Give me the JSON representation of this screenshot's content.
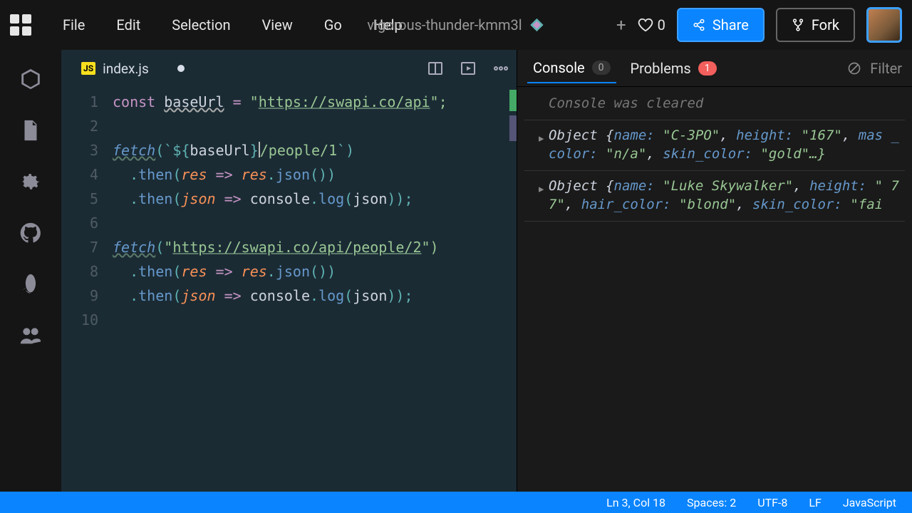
{
  "menu": {
    "file": "File",
    "edit": "Edit",
    "selection": "Selection",
    "view": "View",
    "go": "Go",
    "help": "Help"
  },
  "project_name": "vigorous-thunder-kmm3l",
  "topbar": {
    "plus": "+",
    "likes_count": "0",
    "share": "Share",
    "fork": "Fork"
  },
  "tab": {
    "filename": "index.js",
    "js_badge": "JS"
  },
  "console_tabs": {
    "console": "Console",
    "console_badge": "0",
    "problems": "Problems",
    "problems_badge": "1",
    "filter": "Filter"
  },
  "console": {
    "cleared": "Console was cleared",
    "obj1_a": "Object {",
    "obj1_name_k": "name:",
    "obj1_name_v": "\"C-3PO\"",
    "obj1_height_k": "height:",
    "obj1_height_v": "\"167\"",
    "obj1_mas_k": "mas",
    "obj1_color_k": "_color:",
    "obj1_color_v": "\"n/a\"",
    "obj1_skin_k": "skin_color:",
    "obj1_skin_v": "\"gold\"…}",
    "obj2_a": "Object {",
    "obj2_name_k": "name:",
    "obj2_name_v": "\"Luke Skywalker\"",
    "obj2_height_k": "height:",
    "obj2_height_v": "\"",
    "obj2_77": "77\"",
    "obj2_hair_k": "hair_color:",
    "obj2_hair_v": "\"blond\"",
    "obj2_skin_k": "skin_color:",
    "obj2_skin_v": "\"fai"
  },
  "code": {
    "l1_const": "const ",
    "l1_base": "baseUrl",
    "l1_eq": " = ",
    "l1_q": "\"",
    "l1_url": "https://swapi.co/api",
    "l1_end": "\";",
    "l3_fetch": "fetch",
    "l3_open": "(`",
    "l3_tplO": "${",
    "l3_b": "baseUrl",
    "l3_tplC": "}",
    "l3_path": "/people/1",
    "l3_close": "`)",
    "l4_indent": "  ",
    "l4_dot": ".",
    "l4_then": "then",
    "l4_open": "(",
    "l4_res": "res",
    "l4_arrow": " => ",
    "l4_res2": "res",
    "l4_dot2": ".",
    "l4_json": "json",
    "l4_close": "())",
    "l5_indent": "  ",
    "l5_dot": ".",
    "l5_then": "then",
    "l5_open": "(",
    "l5_json": "json",
    "l5_arrow": " => ",
    "l5_console": "console",
    "l5_dot2": ".",
    "l5_log": "log",
    "l5_open2": "(",
    "l5_json2": "json",
    "l5_close": "));",
    "l7_fetch": "fetch",
    "l7_open": "(",
    "l7_q": "\"",
    "l7_url": "https://swapi.co/api/people/2",
    "l7_close": "\")",
    "l8_indent": "  ",
    "l8_dot": ".",
    "l8_then": "then",
    "l8_open": "(",
    "l8_res": "res",
    "l8_arrow": " => ",
    "l8_res2": "res",
    "l8_dot2": ".",
    "l8_json": "json",
    "l8_close": "())",
    "l9_indent": "  ",
    "l9_dot": ".",
    "l9_then": "then",
    "l9_open": "(",
    "l9_json": "json",
    "l9_arrow": " => ",
    "l9_console": "console",
    "l9_dot2": ".",
    "l9_log": "log",
    "l9_open2": "(",
    "l9_json2": "json",
    "l9_close": "));"
  },
  "status": {
    "pos": "Ln 3, Col 18",
    "spaces": "Spaces: 2",
    "enc": "UTF-8",
    "eol": "LF",
    "lang": "JavaScript"
  },
  "gutter": [
    "1",
    "2",
    "3",
    "4",
    "5",
    "6",
    "7",
    "8",
    "9",
    "10"
  ]
}
